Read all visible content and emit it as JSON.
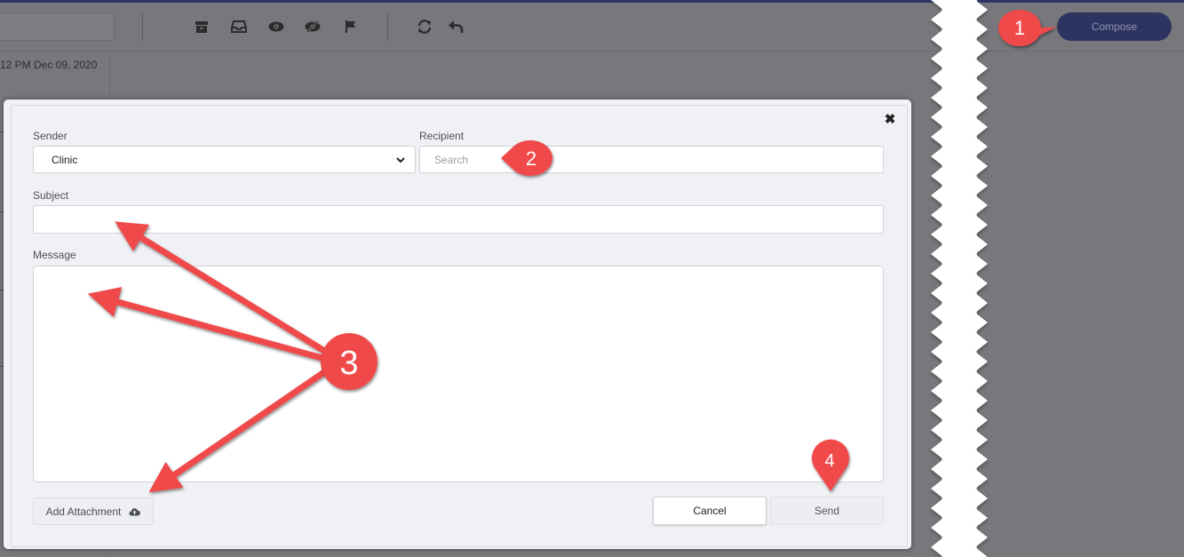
{
  "toolbar": {
    "icons": [
      "archive-icon",
      "inbox-icon",
      "eye-icon",
      "eye-slash-icon",
      "flag-icon",
      "refresh-icon",
      "reply-icon"
    ]
  },
  "message_list": {
    "timestamp": "12 PM Dec 09, 2020"
  },
  "header": {
    "compose_label": "Compose"
  },
  "compose_modal": {
    "close_label": "✖",
    "sender_label": "Sender",
    "sender_value": "Clinic",
    "recipient_label": "Recipient",
    "recipient_placeholder": "Search",
    "subject_label": "Subject",
    "subject_value": "",
    "message_label": "Message",
    "message_value": "",
    "add_attachment_label": "Add Attachment",
    "cancel_label": "Cancel",
    "send_label": "Send"
  },
  "annotations": [
    "1",
    "2",
    "3",
    "4"
  ],
  "colors": {
    "annotation_red": "#f0484a",
    "compose_navy": "#2d3460",
    "overlay_gray": "#78787c"
  }
}
